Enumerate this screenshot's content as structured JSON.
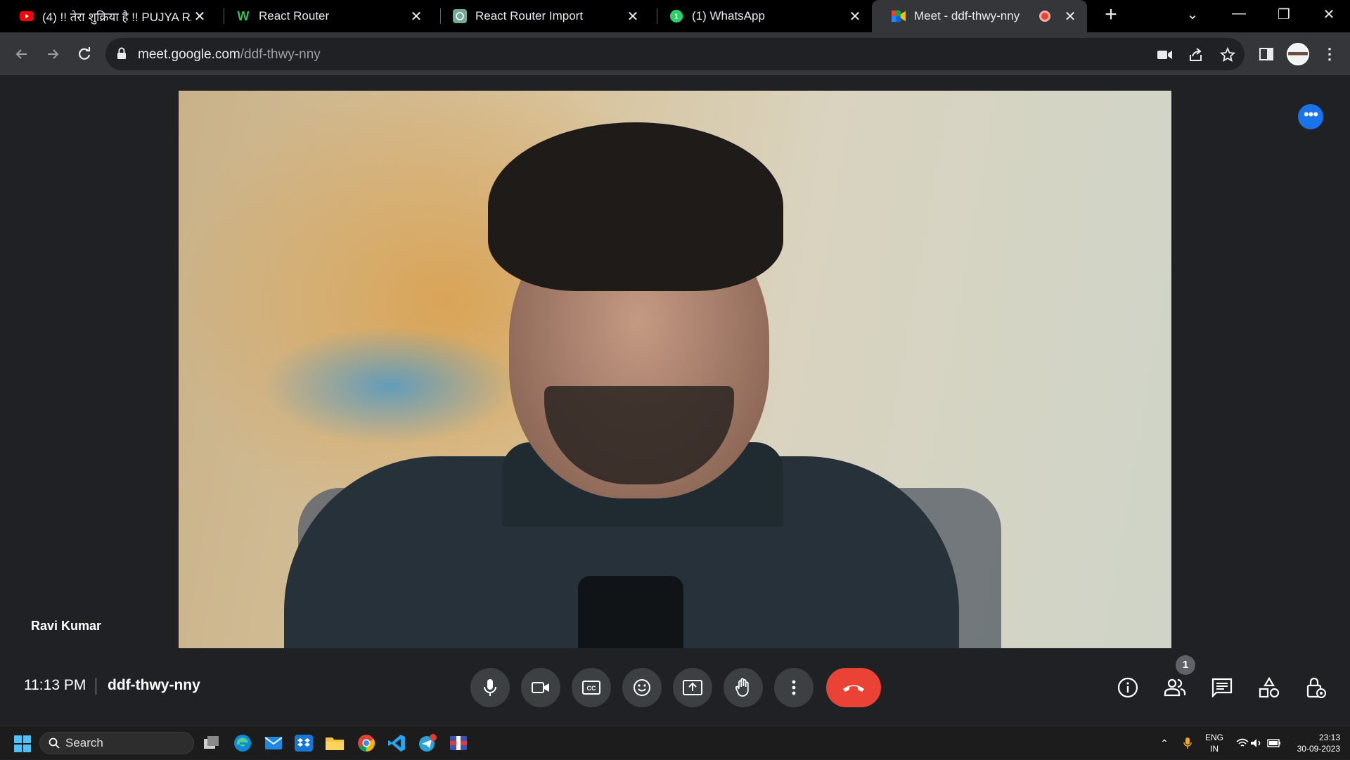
{
  "browser": {
    "tabs": [
      {
        "title": "(4) !! तेरा शुक्रिया है !! PUJYA R/",
        "icon": "youtube-icon",
        "active": false
      },
      {
        "title": "React Router",
        "icon": "w-logo-icon",
        "active": false
      },
      {
        "title": "React Router Import",
        "icon": "chatgpt-icon",
        "active": false
      },
      {
        "title": "(1) WhatsApp",
        "icon": "whatsapp-icon",
        "active": false
      },
      {
        "title": "Meet - ddf-thwy-nny",
        "icon": "google-meet-icon",
        "active": true
      }
    ],
    "new_tab_label": "+",
    "url_domain": "meet.google.com",
    "url_path": "/ddf-thwy-nny"
  },
  "meet": {
    "participant_name": "Ravi Kumar",
    "more_options_label": "•••",
    "time": "11:13 PM",
    "meeting_code": "ddf-thwy-nny",
    "people_count": "1",
    "controls": [
      "microphone-icon",
      "camera-icon",
      "captions-icon",
      "emoji-icon",
      "present-icon",
      "raise-hand-icon",
      "more-vert-icon"
    ],
    "side_controls": [
      "info-icon",
      "people-icon",
      "chat-icon",
      "activities-icon",
      "host-controls-icon"
    ],
    "colors": {
      "end_call": "#ea4335",
      "accent": "#1a73e8",
      "control_bg": "#3c4043"
    }
  },
  "taskbar": {
    "search_label": "Search",
    "lang_top": "ENG",
    "lang_bottom": "IN",
    "time": "23:13",
    "date": "30-09-2023"
  }
}
